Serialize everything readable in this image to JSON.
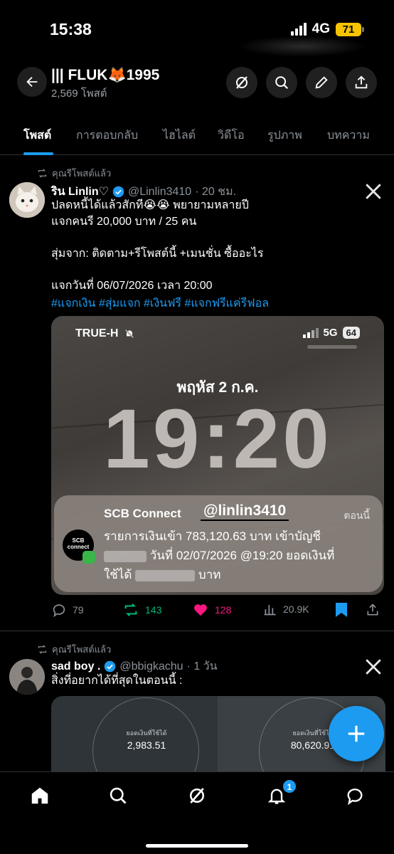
{
  "status_bar": {
    "time": "15:38",
    "network": "4G",
    "battery": "71"
  },
  "header": {
    "title": "||| FLUK🦊1995",
    "subtitle": "2,569 โพสต์"
  },
  "tabs": [
    "โพสต์",
    "การตอบกลับ",
    "ไฮไลต์",
    "วิดีโอ",
    "รูปภาพ",
    "บทความ"
  ],
  "post1": {
    "repost_label": "คุณรีโพสต์แล้ว",
    "name": "ริน Linlin♡",
    "handle": "@Linlin3410",
    "time": "· 20 ชม.",
    "line1": "ปลดหนี้ได้แล้วสักที😭😭 พยายามหลายปี",
    "line2": "แจกคนรี 20,000 บาท / 25 คน",
    "line3": "สุ่มจาก: ติดตาม+รีโพสต์นี้ +เมนชั่น ซื้ออะไร",
    "line4": "แจกวันที่ 06/07/2026 เวลา 20:00",
    "hashtags": "#แจกเงิน #สุ่มแจก #เงินฟรี #แจกฟรีแค่รีฟอล",
    "media": {
      "carrier": "TRUE-H",
      "network": "5G",
      "battery": "64",
      "date": "พฤหัส 2 ก.ค.",
      "clock": "19:20",
      "notification": {
        "app": "SCB Connect",
        "watermark": "@linlin3410",
        "time": "ตอนนี้",
        "icon_text_1": "SCB",
        "icon_text_2": "connect",
        "line1": "รายการเงินเข้า 783,120.63 บาท เข้าบัญชี",
        "line2": "วันที่ 02/07/2026 @19:20 ยอดเงินที่",
        "line3_a": "ใช้ได้",
        "line3_b": "บาท"
      }
    },
    "actions": {
      "replies": "79",
      "reposts": "143",
      "likes": "128",
      "views": "20.9K"
    }
  },
  "post2": {
    "repost_label": "คุณรีโพสต์แล้ว",
    "name": "sad boy .",
    "handle": "@bbigkachu",
    "time": "· 1 วัน",
    "text": "สิ่งที่อยากได้ที่สุดในตอนนี้ :",
    "media": {
      "left_label": "ยอดเงินที่ใช้ได้",
      "left_value": "2,983.51",
      "right_label": "ยอดเงินที่ใช้ได้",
      "right_value": "80,620.91"
    }
  },
  "bottom_nav": {
    "notification_count": "1"
  },
  "colors": {
    "accent": "#1d9bf0",
    "repost_green": "#00ba7c",
    "like_pink": "#f91880",
    "background": "#000000"
  }
}
